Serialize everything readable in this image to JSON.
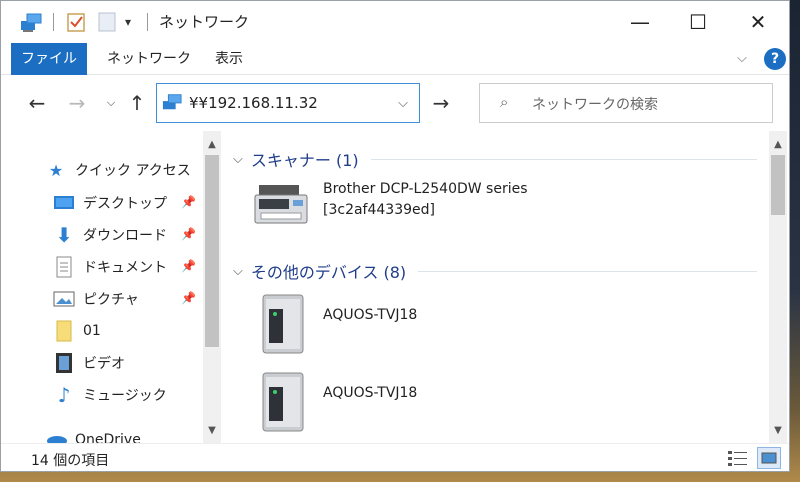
{
  "window": {
    "title": "ネットワーク",
    "controls": {
      "minimize": "—",
      "maximize": "☐",
      "close": "✕"
    }
  },
  "ribbon": {
    "tabs": [
      {
        "label": "ファイル",
        "active": true
      },
      {
        "label": "ネットワーク",
        "active": false
      },
      {
        "label": "表示",
        "active": false
      }
    ]
  },
  "address": {
    "path": "¥¥192.168.11.32"
  },
  "search": {
    "placeholder": "ネットワークの検索"
  },
  "navpane": {
    "quick_access": "クイック アクセス",
    "items": [
      {
        "label": "デスクトップ",
        "icon": "desktop-icon",
        "pinned": true
      },
      {
        "label": "ダウンロード",
        "icon": "download-icon",
        "pinned": true
      },
      {
        "label": "ドキュメント",
        "icon": "documents-icon",
        "pinned": true
      },
      {
        "label": "ピクチャ",
        "icon": "pictures-icon",
        "pinned": true
      },
      {
        "label": "01",
        "icon": "folder-icon",
        "pinned": false
      },
      {
        "label": "ビデオ",
        "icon": "video-icon",
        "pinned": false
      },
      {
        "label": "ミュージック",
        "icon": "music-icon",
        "pinned": false
      },
      {
        "label": "OneDrive",
        "icon": "onedrive-icon",
        "pinned": false
      }
    ]
  },
  "content": {
    "groups": [
      {
        "label": "スキャナー (1)",
        "items": [
          {
            "name": "Brother DCP-L2540DW series",
            "detail": "[3c2af44339ed]",
            "icon": "printer-icon"
          }
        ]
      },
      {
        "label": "その他のデバイス (8)",
        "items": [
          {
            "name": "AQUOS-TVJ18",
            "icon": "device-icon"
          },
          {
            "name": "AQUOS-TVJ18",
            "icon": "device-icon"
          }
        ]
      }
    ]
  },
  "status": {
    "count": "14 個の項目"
  },
  "colors": {
    "accent": "#1b6ec2",
    "group_header": "#1f3d8a",
    "address_border": "#3c8fd8"
  }
}
